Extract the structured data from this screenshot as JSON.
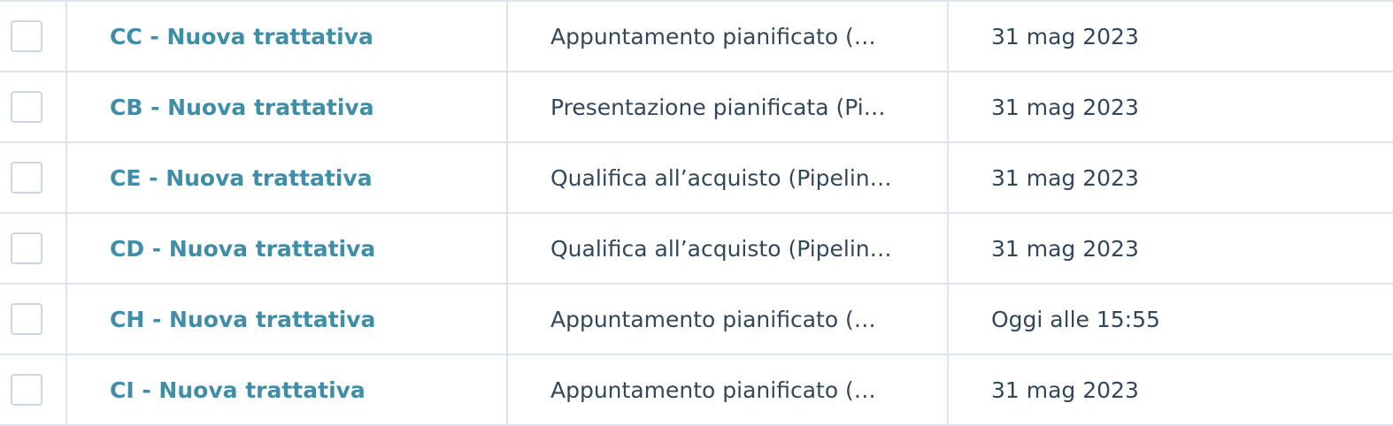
{
  "table": {
    "rows": [
      {
        "name": "CC - Nuova trattativa",
        "stage": "Appuntamento pianificato (…",
        "date": "31 mag 2023"
      },
      {
        "name": "CB - Nuova trattativa",
        "stage": "Presentazione pianificata (Pi…",
        "date": "31 mag 2023"
      },
      {
        "name": "CE - Nuova trattativa",
        "stage": "Qualifica all’acquisto (Pipelin…",
        "date": "31 mag 2023"
      },
      {
        "name": "CD - Nuova trattativa",
        "stage": "Qualifica all’acquisto (Pipelin…",
        "date": "31 mag 2023"
      },
      {
        "name": "CH - Nuova trattativa",
        "stage": "Appuntamento pianificato (…",
        "date": "Oggi alle 15:55"
      },
      {
        "name": "CI - Nuova trattativa",
        "stage": "Appuntamento pianificato (…",
        "date": "31 mag 2023"
      }
    ]
  }
}
